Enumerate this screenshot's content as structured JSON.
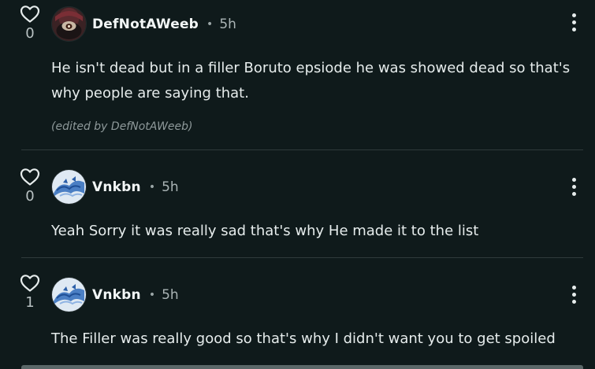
{
  "comments": [
    {
      "likes": "0",
      "username": "DefNotAWeeb",
      "separator": "•",
      "time": "5h",
      "avatar_icon": "dark-character-avatar",
      "text": "He isn't dead but in a filler Boruto epsiode he was showed dead so that's why people are saying that.",
      "edited_note": "(edited by DefNotAWeeb)"
    },
    {
      "likes": "0",
      "username": "Vnkbn",
      "separator": "•",
      "time": "5h",
      "avatar_icon": "blue-dragon-avatar",
      "text": "Yeah Sorry it was really sad that's why He made it to the list"
    },
    {
      "likes": "1",
      "username": "Vnkbn",
      "separator": "•",
      "time": "5h",
      "avatar_icon": "blue-dragon-avatar",
      "text": "The Filler was really good so that's why I didn't want you to get spoiled"
    }
  ],
  "colors": {
    "background": "#0f1a1b",
    "text": "#e6ecec",
    "muted": "#aab4b5",
    "divider": "#2f3b3c"
  }
}
